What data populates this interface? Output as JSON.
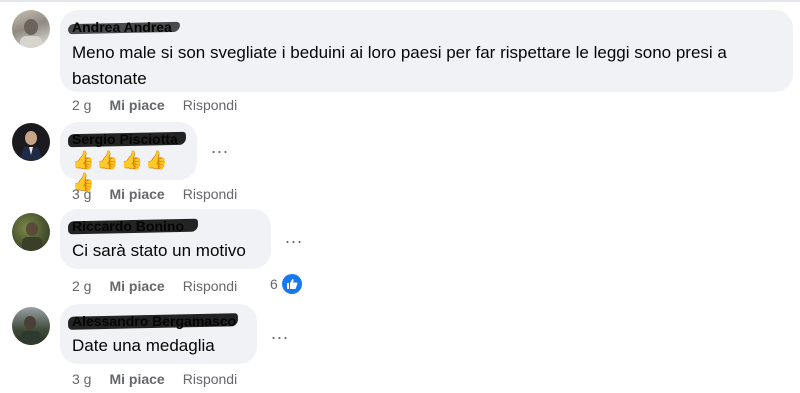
{
  "comments": [
    {
      "author": "Andrea Andrea",
      "text": "Meno male si son svegliate i beduini ai loro paesi per far rispettare le leggi sono presi a bastonate",
      "time": "2 g",
      "like_label": "Mi piace",
      "reply_label": "Rispondi"
    },
    {
      "author": "Sergio Pisciotta",
      "text": "👍👍👍👍👍",
      "time": "3 g",
      "like_label": "Mi piace",
      "reply_label": "Rispondi",
      "more": "..."
    },
    {
      "author": "Riccardo Bonino",
      "text": "Ci sarà stato un motivo",
      "time": "2 g",
      "like_label": "Mi piace",
      "reply_label": "Rispondi",
      "more": "...",
      "reaction_count": "6"
    },
    {
      "author": "Alessandro Bergamasco",
      "text": "Date una medaglia",
      "time": "3 g",
      "like_label": "Mi piace",
      "reply_label": "Rispondi",
      "more": "..."
    }
  ],
  "colors": {
    "bubble": "#f0f2f5",
    "meta_text": "#65676b",
    "like_blue": "#1877f2"
  }
}
